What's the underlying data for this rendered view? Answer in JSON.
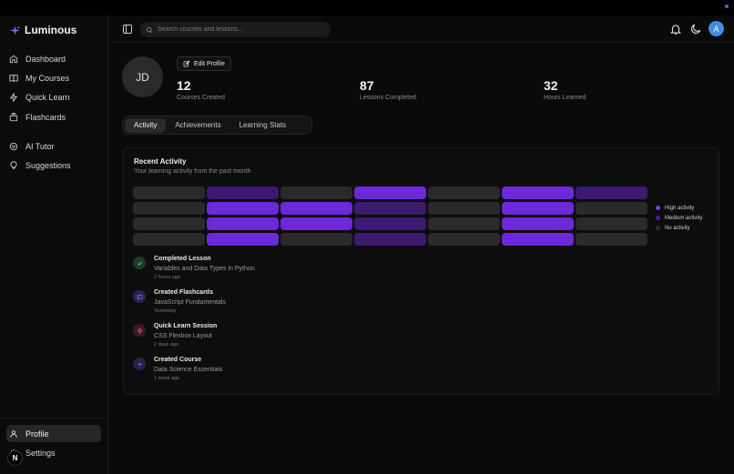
{
  "brand": {
    "name": "Luminous",
    "accent": "#8b5cf6"
  },
  "sidebar": {
    "items": [
      {
        "label": "Dashboard",
        "icon": "home-icon"
      },
      {
        "label": "My Courses",
        "icon": "book-icon"
      },
      {
        "label": "Quick Learn",
        "icon": "zap-icon"
      },
      {
        "label": "Flashcards",
        "icon": "stack-icon"
      },
      {
        "label": "AI Tutor",
        "icon": "bot-icon"
      },
      {
        "label": "Suggestions",
        "icon": "lightbulb-icon"
      }
    ],
    "bottom": [
      {
        "label": "Profile",
        "icon": "user-icon",
        "active": true
      },
      {
        "label": "Settings",
        "icon": "gear-icon"
      }
    ],
    "badge": "N"
  },
  "header": {
    "search_placeholder": "Search courses and lessons...",
    "avatar_letter": "A"
  },
  "profile": {
    "initials": "JD",
    "edit_label": "Edit Profile",
    "stats": [
      {
        "value": "12",
        "label": "Courses Created"
      },
      {
        "value": "87",
        "label": "Lessons Completed"
      },
      {
        "value": "32",
        "label": "Hours Learned"
      }
    ]
  },
  "tabs": [
    {
      "label": "Activity",
      "active": true
    },
    {
      "label": "Achievements"
    },
    {
      "label": "Learning Stats"
    }
  ],
  "recent": {
    "title": "Recent Activity",
    "subtitle": "Your learning activity from the past month",
    "heatmap": [
      [
        "none",
        "medium",
        "none",
        "high",
        "none",
        "high",
        "medium"
      ],
      [
        "none",
        "high",
        "high",
        "medium",
        "none",
        "high",
        "none"
      ],
      [
        "none",
        "high",
        "high",
        "medium",
        "none",
        "high",
        "none"
      ],
      [
        "none",
        "high",
        "none",
        "medium",
        "none",
        "high",
        "none"
      ]
    ],
    "legend": [
      {
        "label": "High activity",
        "color": "#7c3aed"
      },
      {
        "label": "Medium activity",
        "color": "#4c1d95"
      },
      {
        "label": "No activity",
        "color": "#2d2d2d"
      }
    ],
    "colors": {
      "high": "#6d28d9",
      "medium": "#3b1a70",
      "none": "#2a2a2a"
    },
    "items": [
      {
        "title": "Completed Lesson",
        "detail": "Variables and Data Types in Python",
        "time": "2 hours ago",
        "icon": "check-icon",
        "color": "#4ade80",
        "bg": "#1f3a2a"
      },
      {
        "title": "Created Flashcards",
        "detail": "JavaScript Fundamentals",
        "time": "Yesterday",
        "icon": "cards-icon",
        "color": "#7c6cf0",
        "bg": "#2a2350"
      },
      {
        "title": "Quick Learn Session",
        "detail": "CSS Flexbox Layout",
        "time": "2 days ago",
        "icon": "zap-icon",
        "color": "#e0506a",
        "bg": "#3a1c26"
      },
      {
        "title": "Created Course",
        "detail": "Data Science Essentials",
        "time": "1 week ago",
        "icon": "sparkle-icon",
        "color": "#8b5cf6",
        "bg": "#2a2048"
      }
    ]
  }
}
